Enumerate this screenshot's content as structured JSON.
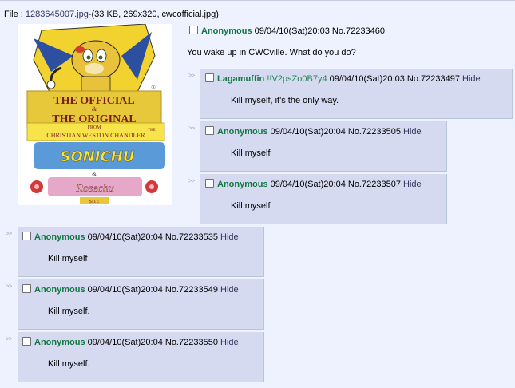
{
  "file": {
    "prefix": "File : ",
    "link": "1283645007.jpg",
    "details": "-(33 KB, 269x320, cwcofficial.jpg)"
  },
  "thumbnail": {
    "line1": "THE OFFICIAL",
    "amp1": "&",
    "line2": "THE ORIGINAL",
    "from": "FROM",
    "author": "CHRISTIAN WESTON CHANDLER",
    "the": "THE",
    "sonichu": "SONICHU",
    "amp2": "&",
    "rosechu": "Rosechu",
    "site": "SITE",
    "reg": "®"
  },
  "op": {
    "name": "Anonymous",
    "datetime": "09/04/10(Sat)20:03",
    "number": "No.72233460",
    "message": "You wake up in CWCville. What do you do?"
  },
  "arrows": ">>",
  "replies": [
    {
      "name": "Lagamuffin",
      "trip": "!!V2psZo0B7y4",
      "datetime": "09/04/10(Sat)20:03",
      "number": "No.72233497",
      "hide": "Hide",
      "message": "Kill myself, it's the only way."
    },
    {
      "name": "Anonymous",
      "trip": "",
      "datetime": "09/04/10(Sat)20:04",
      "number": "No.72233505",
      "hide": "Hide",
      "message": "Kill myself"
    },
    {
      "name": "Anonymous",
      "trip": "",
      "datetime": "09/04/10(Sat)20:04",
      "number": "No.72233507",
      "hide": "Hide",
      "message": "Kill myself"
    },
    {
      "name": "Anonymous",
      "trip": "",
      "datetime": "09/04/10(Sat)20:04",
      "number": "No.72233535",
      "hide": "Hide",
      "message": "Kill myself"
    },
    {
      "name": "Anonymous",
      "trip": "",
      "datetime": "09/04/10(Sat)20:04",
      "number": "No.72233549",
      "hide": "Hide",
      "message": "Kill myself."
    },
    {
      "name": "Anonymous",
      "trip": "",
      "datetime": "09/04/10(Sat)20:04",
      "number": "No.72233550",
      "hide": "Hide",
      "message": "Kill myself."
    }
  ],
  "colors": {
    "background": "#eef2ff",
    "reply_background": "#d6daf0",
    "name_green": "#117743",
    "link_blue": "#34345c"
  }
}
